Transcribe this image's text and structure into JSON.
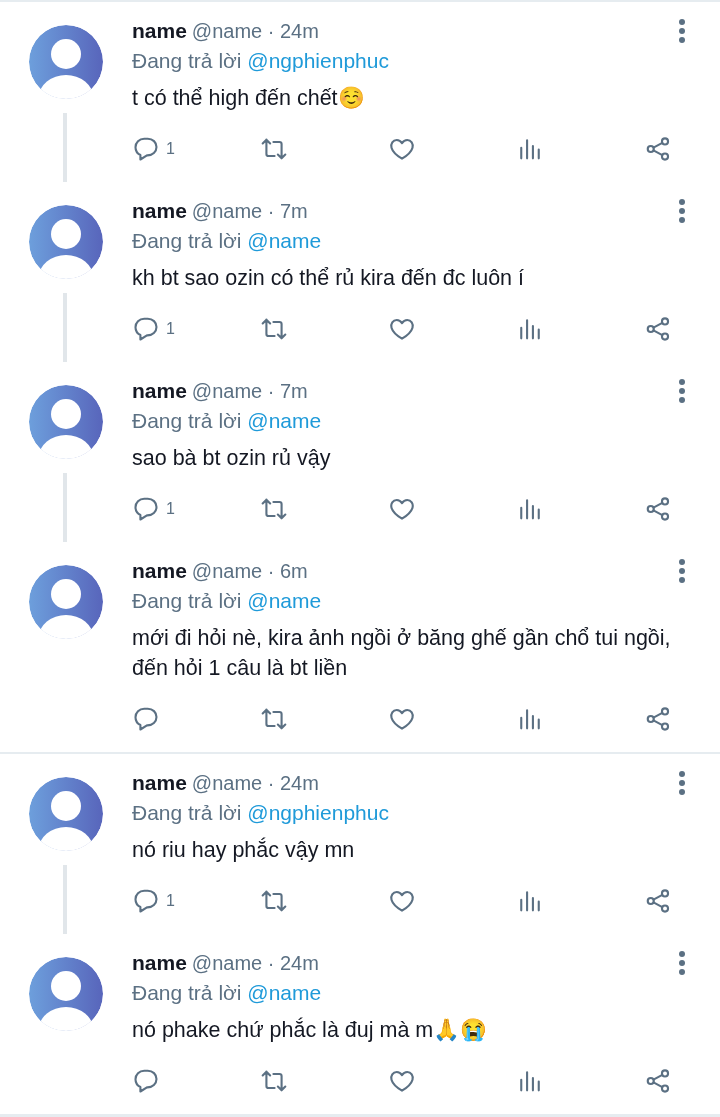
{
  "threads": [
    {
      "tweets": [
        {
          "author": "name",
          "meta": "@name · 24m",
          "replying_to": {
            "prefix": "Đang trả lời",
            "mention": "@ngphienphuc"
          },
          "body": "t có thể high đến chết☺️",
          "reply_count": "1"
        },
        {
          "author": "name",
          "meta": "@name · 7m",
          "replying_to": {
            "prefix": "Đang trả lời",
            "mention": "@name"
          },
          "body": "kh bt sao ozin có thể rủ kira đến đc luôn í",
          "reply_count": "1"
        },
        {
          "author": "name",
          "meta": "@name · 7m",
          "replying_to": {
            "prefix": "Đang trả lời",
            "mention": "@name"
          },
          "body": "sao bà bt ozin rủ vậy",
          "reply_count": "1"
        },
        {
          "author": "name",
          "meta": "@name · 6m",
          "replying_to": {
            "prefix": "Đang trả lời",
            "mention": "@name"
          },
          "body": "mới đi hỏi nè, kira ảnh ngồi ở băng ghế gần chổ tui ngồi, đến hỏi 1 câu là bt liền"
        }
      ]
    },
    {
      "tweets": [
        {
          "author": "name",
          "meta": "@name · 24m",
          "replying_to": {
            "prefix": "Đang trả lời",
            "mention": "@ngphienphuc"
          },
          "body": "nó riu hay phắc vậy mn",
          "reply_count": "1"
        },
        {
          "author": "name",
          "meta": "@name · 24m",
          "replying_to": {
            "prefix": "Đang trả lời",
            "mention": "@name"
          },
          "body": "nó phake chứ phắc là đuj mà m🙏😭"
        }
      ]
    }
  ]
}
